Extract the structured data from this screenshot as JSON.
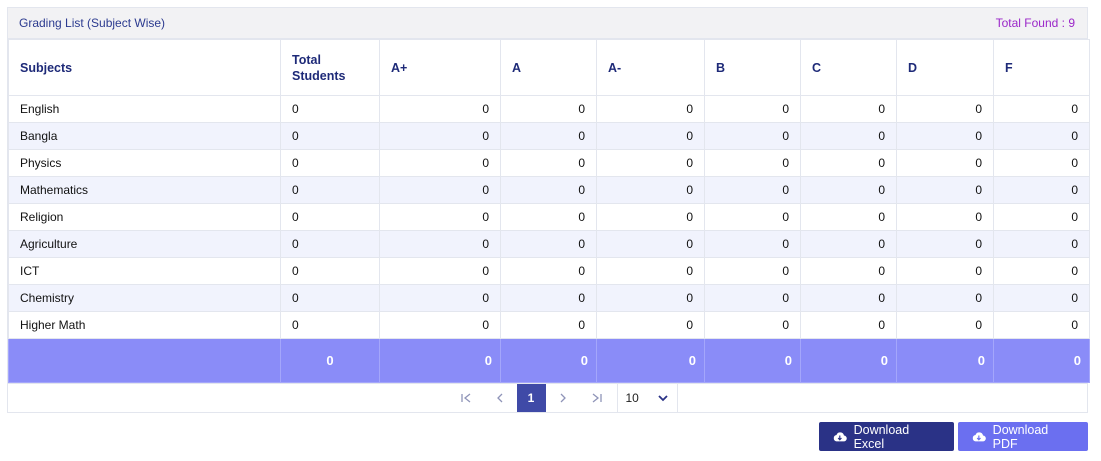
{
  "header": {
    "title": "Grading List (Subject Wise)",
    "total_found": "Total Found : 9"
  },
  "table": {
    "columns": [
      "Subjects",
      "Total\nStudents",
      "A+",
      "A",
      "A-",
      "B",
      "C",
      "D",
      "F"
    ],
    "rows": [
      {
        "subject": "English",
        "values": [
          "0",
          "0",
          "0",
          "0",
          "0",
          "0",
          "0",
          "0"
        ]
      },
      {
        "subject": "Bangla",
        "values": [
          "0",
          "0",
          "0",
          "0",
          "0",
          "0",
          "0",
          "0"
        ]
      },
      {
        "subject": "Physics",
        "values": [
          "0",
          "0",
          "0",
          "0",
          "0",
          "0",
          "0",
          "0"
        ]
      },
      {
        "subject": "Mathematics",
        "values": [
          "0",
          "0",
          "0",
          "0",
          "0",
          "0",
          "0",
          "0"
        ]
      },
      {
        "subject": "Religion",
        "values": [
          "0",
          "0",
          "0",
          "0",
          "0",
          "0",
          "0",
          "0"
        ]
      },
      {
        "subject": "Agriculture",
        "values": [
          "0",
          "0",
          "0",
          "0",
          "0",
          "0",
          "0",
          "0"
        ]
      },
      {
        "subject": "ICT",
        "values": [
          "0",
          "0",
          "0",
          "0",
          "0",
          "0",
          "0",
          "0"
        ]
      },
      {
        "subject": "Chemistry",
        "values": [
          "0",
          "0",
          "0",
          "0",
          "0",
          "0",
          "0",
          "0"
        ]
      },
      {
        "subject": "Higher Math",
        "values": [
          "0",
          "0",
          "0",
          "0",
          "0",
          "0",
          "0",
          "0"
        ]
      }
    ],
    "totals": [
      "0",
      "0",
      "0",
      "0",
      "0",
      "0",
      "0",
      "0"
    ]
  },
  "pager": {
    "current_page": "1",
    "page_size": "10",
    "icons": [
      "first-page-icon",
      "prev-page-icon",
      "next-page-icon",
      "last-page-icon",
      "chevron-down-icon"
    ]
  },
  "actions": {
    "excel_label": "Download Excel",
    "pdf_label": "Download PDF",
    "icon": "cloud-download-icon"
  },
  "colors": {
    "header_text": "#1e2a78",
    "total_found": "#9b27c9",
    "footer_bg": "#8a8cf8",
    "excel_btn": "#2a3286",
    "pdf_btn": "#6b6ff0",
    "current_page": "#3f4aa7"
  }
}
